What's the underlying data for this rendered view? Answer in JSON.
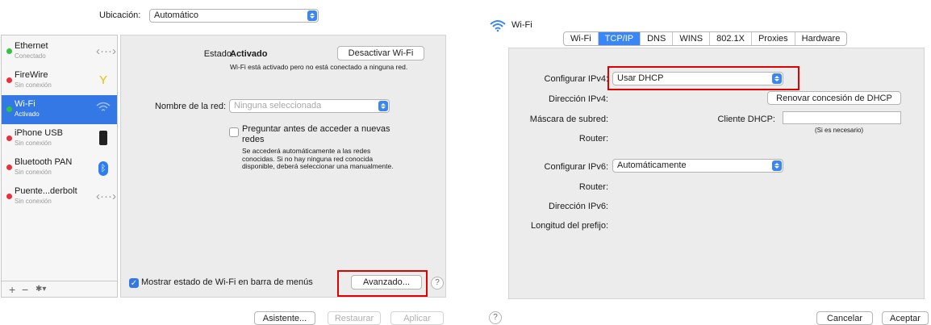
{
  "left": {
    "location_label": "Ubicación:",
    "location_value": "Automático",
    "services": [
      {
        "name": "Ethernet",
        "status": "Conectado",
        "dot": "#2fc53a",
        "icon": "ethernet-arrows-icon"
      },
      {
        "name": "FireWire",
        "status": "Sin conexión",
        "dot": "#e7323c",
        "icon": "firewire-icon"
      },
      {
        "name": "Wi-Fi",
        "status": "Activado",
        "dot": "#2fc53a",
        "icon": "wifi-icon"
      },
      {
        "name": "iPhone USB",
        "status": "Sin conexión",
        "dot": "#e7323c",
        "icon": "iphone-icon"
      },
      {
        "name": "Bluetooth PAN",
        "status": "Sin conexión",
        "dot": "#e7323c",
        "icon": "bluetooth-icon"
      },
      {
        "name": "Puente...derbolt",
        "status": "Sin conexión",
        "dot": "#e7323c",
        "icon": "bridge-arrows-icon"
      }
    ],
    "bottom": {
      "add": "+",
      "remove": "−",
      "gear": "✱▾"
    },
    "status_label": "Estado:",
    "status_value": "Activado",
    "turn_off_button": "Desactivar Wi-Fi",
    "status_desc": "Wi-Fi está activado pero no está conectado a ninguna red.",
    "network_label": "Nombre de la red:",
    "network_value": "Ninguna seleccionada",
    "ask_checkbox_label": "Preguntar antes de acceder a nuevas redes",
    "ask_desc": "Se accederá automáticamente a las redes conocidas. Si no hay ninguna red conocida disponible, deberá seleccionar una manualmente.",
    "show_status_label": "Mostrar estado de Wi-Fi en barra de menús",
    "advanced_button": "Avanzado...",
    "help": "?",
    "assistant_button": "Asistente...",
    "revert_button": "Restaurar",
    "apply_button": "Aplicar"
  },
  "right": {
    "title": "Wi-Fi",
    "tabs": [
      "Wi-Fi",
      "TCP/IP",
      "DNS",
      "WINS",
      "802.1X",
      "Proxies",
      "Hardware"
    ],
    "selected_tab": "TCP/IP",
    "configure_ipv4_label": "Configurar IPv4:",
    "configure_ipv4_value": "Usar DHCP",
    "ipv4_address_label": "Dirección IPv4:",
    "renew_button": "Renovar concesión de DHCP",
    "subnet_label": "Máscara de subred:",
    "dhcp_client_label": "Cliente DHCP:",
    "dhcp_client_hint": "(Si es necesario)",
    "router_label": "Router:",
    "configure_ipv6_label": "Configurar IPv6:",
    "configure_ipv6_value": "Automáticamente",
    "router6_label": "Router:",
    "ipv6_address_label": "Dirección IPv6:",
    "prefix_label": "Longitud del prefijo:",
    "help": "?",
    "cancel_button": "Cancelar",
    "ok_button": "Aceptar"
  },
  "colors": {
    "accent": "#3478e5",
    "highlight": "#e00000"
  }
}
